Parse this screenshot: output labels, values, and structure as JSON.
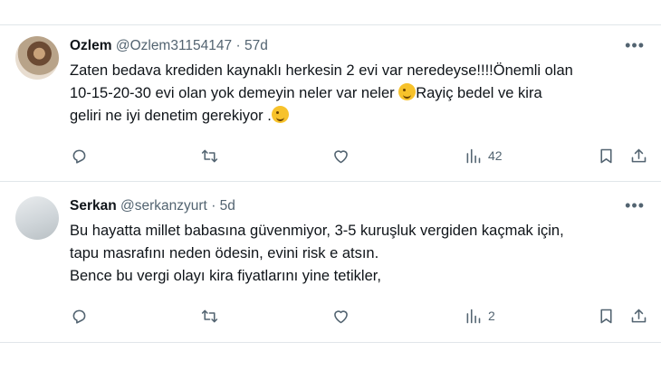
{
  "tweets": [
    {
      "name": "Ozlem",
      "handle": "@Ozlem31154147",
      "dot": "·",
      "time": "57d",
      "lines": [
        "Zaten bedava krediden kaynaklı herkesin 2 evi var neredeyse!!!!Önemli olan",
        "10-15-20-30 evi olan yok demeyin neler var neler",
        "Rayiç bedel ve kira",
        "geliri ne iyi denetim gerekiyor ."
      ],
      "views": "42"
    },
    {
      "name": "Serkan",
      "handle": "@serkanzyurt",
      "dot": "·",
      "time": "5d",
      "lines": [
        "Bu hayatta millet babasına güvenmiyor, 3-5 kuruşluk vergiden kaçmak için,",
        "tapu masrafını neden ödesin, evini risk e atsın.",
        "Bence bu vergi olayı kira fiyatlarını yine tetikler,"
      ],
      "views": "2"
    }
  ],
  "icons": {
    "more": "more-icon",
    "reply": "reply-icon",
    "retweet": "retweet-icon",
    "like": "like-icon",
    "views": "views-icon",
    "bookmark": "bookmark-icon",
    "share": "share-icon"
  },
  "colors": {
    "muted": "#536471",
    "text": "#0f1419",
    "divider": "#e1e6ea"
  }
}
